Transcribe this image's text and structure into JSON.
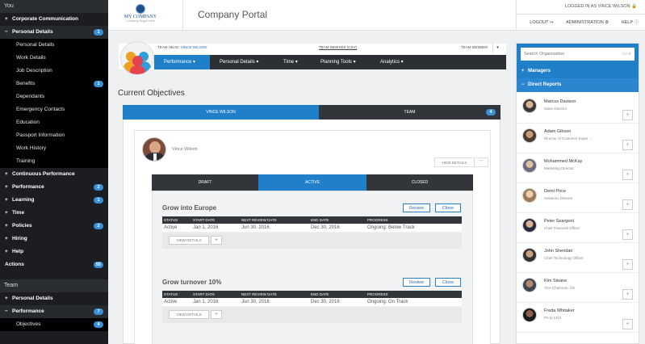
{
  "sidebar": {
    "you_label": "You",
    "items": [
      {
        "label": "Corporate Communication",
        "toggle": "+",
        "badge": ""
      },
      {
        "label": "Personal Details",
        "toggle": "−",
        "badge": "1"
      }
    ],
    "personal_sub": [
      {
        "label": "Personal Details",
        "badge": ""
      },
      {
        "label": "Work Details",
        "badge": ""
      },
      {
        "label": "Job Description",
        "badge": ""
      },
      {
        "label": "Benefits",
        "badge": "1"
      },
      {
        "label": "Dependants",
        "badge": ""
      },
      {
        "label": "Emergency Contacts",
        "badge": ""
      },
      {
        "label": "Education",
        "badge": ""
      },
      {
        "label": "Passport Information",
        "badge": ""
      },
      {
        "label": "Work History",
        "badge": ""
      },
      {
        "label": "Training",
        "badge": ""
      }
    ],
    "more_items": [
      {
        "label": "Continuous Performance",
        "toggle": "+",
        "badge": ""
      },
      {
        "label": "Performance",
        "toggle": "+",
        "badge": "2"
      },
      {
        "label": "Learning",
        "toggle": "+",
        "badge": "1"
      },
      {
        "label": "Time",
        "toggle": "+",
        "badge": ""
      },
      {
        "label": "Policies",
        "toggle": "+",
        "badge": "2"
      },
      {
        "label": "Hiring",
        "toggle": "+",
        "badge": ""
      },
      {
        "label": "Help",
        "toggle": "+",
        "badge": ""
      },
      {
        "label": "Actions",
        "toggle": "",
        "badge": "55"
      }
    ],
    "team_label": "Team",
    "team_items": [
      {
        "label": "Personal Details",
        "toggle": "+",
        "badge": ""
      },
      {
        "label": "Performance",
        "toggle": "−",
        "badge": "7"
      }
    ],
    "team_sub": [
      {
        "label": "Objectives",
        "badge": "4"
      }
    ]
  },
  "header": {
    "logo_text": "MY COMPANY",
    "logo_tagline": "Company Slogan Here",
    "title": "Company Portal",
    "logged_in": "LOGGED IN AS VINCE WILSON",
    "logout": "LOGOUT",
    "administration": "ADMINISTRATION",
    "help": "HELP"
  },
  "team_card": {
    "head_prefix": "TEAM HEAD:",
    "head_name": "VINCE WILSON",
    "link": "TEAM INDEXES (CSV)",
    "member": "TEAM MEMBER",
    "caret": "▾",
    "nav": [
      "Performance ▾",
      "Personal Details ▾",
      "Time ▾",
      "Planning Tools ▾",
      "Analytics ▾"
    ]
  },
  "main": {
    "section_title": "Current Objectives",
    "tabs": [
      {
        "label": "VINCE WILSON",
        "badge": ""
      },
      {
        "label": "TEAM",
        "badge": "4"
      }
    ],
    "person_name": "Vince Wilson",
    "hide_details": "HIDE DETAILS",
    "status_tabs": [
      "DRAFT",
      "ACTIVE",
      "CLOSED"
    ],
    "table_headers": [
      "STATUS",
      "START DATE",
      "NEXT REVIEW DATE",
      "END DATE",
      "PROGRESS"
    ],
    "review_label": "Review",
    "clone_label": "Clone",
    "view_details": "VIEW DETAILS",
    "plus": "+",
    "objectives": [
      {
        "title": "Grow into Europe",
        "status": "Active",
        "start": "Jan 1, 2016",
        "next_review": "Jun 30, 2016",
        "end": "Dec 30, 2016",
        "progress": "Ongoing: Below Track"
      },
      {
        "title": "Grow turnover 10%",
        "status": "Active",
        "start": "Jan 1, 2016",
        "next_review": "Jun 30, 2016",
        "end": "Dec 30, 2016",
        "progress": "Ongoing: On Track"
      }
    ]
  },
  "right_panel": {
    "search_placeholder": "Search Organisation",
    "managers": "Managers",
    "direct_reports": "Direct Reports",
    "contacts": [
      {
        "name": "Marcus Davison",
        "title": "Sales Director"
      },
      {
        "name": "Adam Gibson",
        "title": "Director of Customer Exper ..."
      },
      {
        "name": "Mohammed McKay",
        "title": "Marketing Director"
      },
      {
        "name": "Demi Price",
        "title": "Solutions Director"
      },
      {
        "name": "Peter Seargent",
        "title": "Chief Financial Officer"
      },
      {
        "name": "John Sheridan",
        "title": "Chief Technology Officer"
      },
      {
        "name": "Kim Sloane",
        "title": "Vice Chairman, US"
      },
      {
        "name": "Freda Whitaker",
        "title": "PA to CEO"
      }
    ]
  },
  "colors": {
    "accent": "#1f7fc9",
    "sidebar": "#1b1d20",
    "nav_dark": "#2c2f33"
  }
}
